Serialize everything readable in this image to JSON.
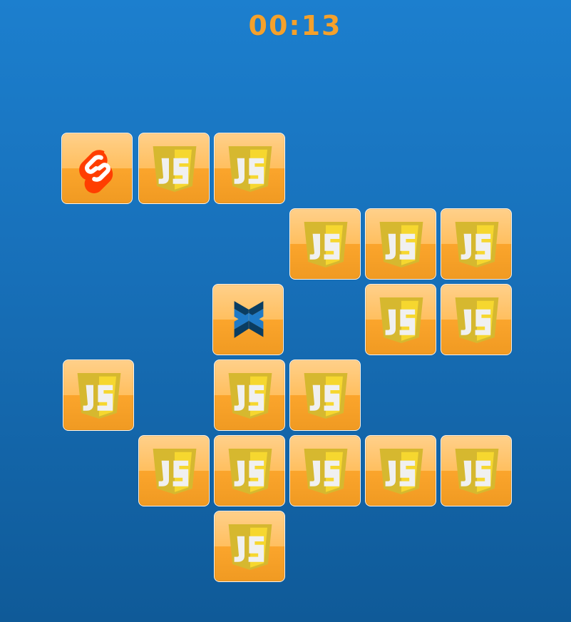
{
  "timer": {
    "text": "00:13"
  },
  "board": {
    "tiles": [
      {
        "id": "tile-1",
        "icon": "svelte-icon"
      },
      {
        "id": "tile-2",
        "icon": "javascript-icon"
      },
      {
        "id": "tile-3",
        "icon": "javascript-icon"
      },
      {
        "id": "tile-4",
        "icon": "javascript-icon"
      },
      {
        "id": "tile-5",
        "icon": "javascript-icon"
      },
      {
        "id": "tile-6",
        "icon": "javascript-icon"
      },
      {
        "id": "tile-7",
        "icon": "backbone-icon"
      },
      {
        "id": "tile-8",
        "icon": "javascript-icon"
      },
      {
        "id": "tile-9",
        "icon": "javascript-icon"
      },
      {
        "id": "tile-10",
        "icon": "javascript-icon"
      },
      {
        "id": "tile-11",
        "icon": "javascript-icon"
      },
      {
        "id": "tile-12",
        "icon": "javascript-icon"
      },
      {
        "id": "tile-13",
        "icon": "javascript-icon"
      },
      {
        "id": "tile-14",
        "icon": "javascript-icon"
      },
      {
        "id": "tile-15",
        "icon": "javascript-icon"
      },
      {
        "id": "tile-16",
        "icon": "javascript-icon"
      },
      {
        "id": "tile-17",
        "icon": "javascript-icon"
      },
      {
        "id": "tile-18",
        "icon": "javascript-icon"
      }
    ]
  }
}
